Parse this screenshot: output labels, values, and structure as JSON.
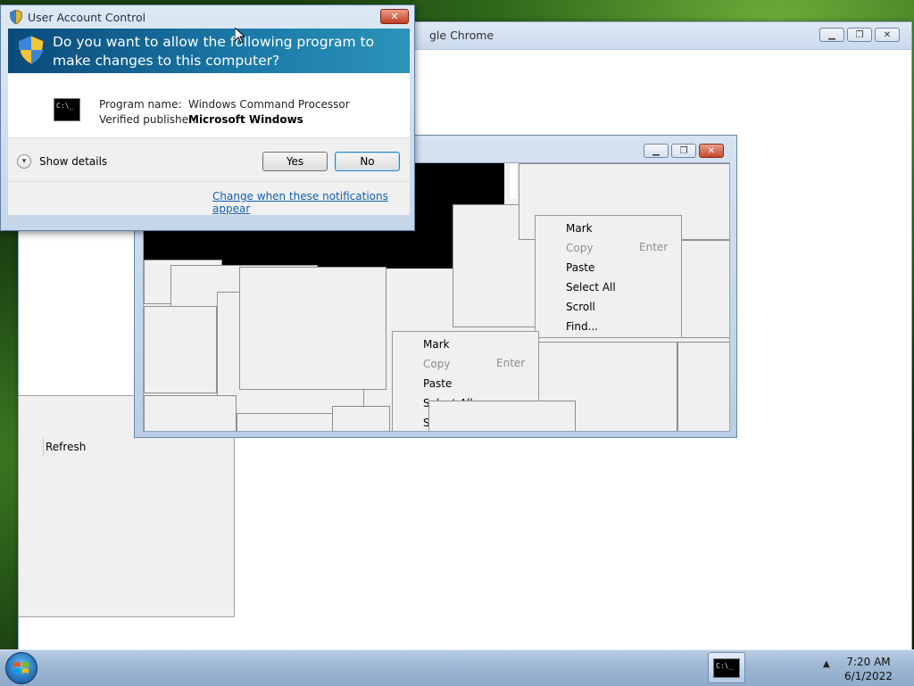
{
  "chrome_window": {
    "title": "gle Chrome"
  },
  "grey_panel": {
    "refresh_label": "Refresh"
  },
  "cmd_window": {
    "context_menu_1": {
      "items": [
        {
          "label": "Mark",
          "shortcut": "",
          "enabled": true
        },
        {
          "label": "Copy",
          "shortcut": "Enter",
          "enabled": false
        },
        {
          "label": "Paste",
          "shortcut": "",
          "enabled": true
        },
        {
          "label": "Select All",
          "shortcut": "",
          "enabled": true
        },
        {
          "label": "Scroll",
          "shortcut": "",
          "enabled": true
        },
        {
          "label": "Find...",
          "shortcut": "",
          "enabled": true
        }
      ]
    },
    "context_menu_2": {
      "items": [
        {
          "label": "Mark",
          "shortcut": "",
          "enabled": true
        },
        {
          "label": "Copy",
          "shortcut": "Enter",
          "enabled": false
        },
        {
          "label": "Paste",
          "shortcut": "",
          "enabled": true
        },
        {
          "label": "Select All",
          "shortcut": "",
          "enabled": true
        },
        {
          "label": "Scroll",
          "shortcut": "",
          "enabled": true
        }
      ]
    }
  },
  "uac": {
    "title": "User Account Control",
    "question": "Do you want to allow the following program to make changes to this computer?",
    "program_name_label": "Program name:",
    "program_name": "Windows Command Processor",
    "publisher_label": "Verified publisher:",
    "publisher": "Microsoft Windows",
    "show_details": "Show details",
    "yes": "Yes",
    "no": "No",
    "change_link": "Change when these notifications appear",
    "icon_text": "C:\\_"
  },
  "taskbar": {
    "time": "7:20 AM",
    "date": "6/1/2022"
  }
}
